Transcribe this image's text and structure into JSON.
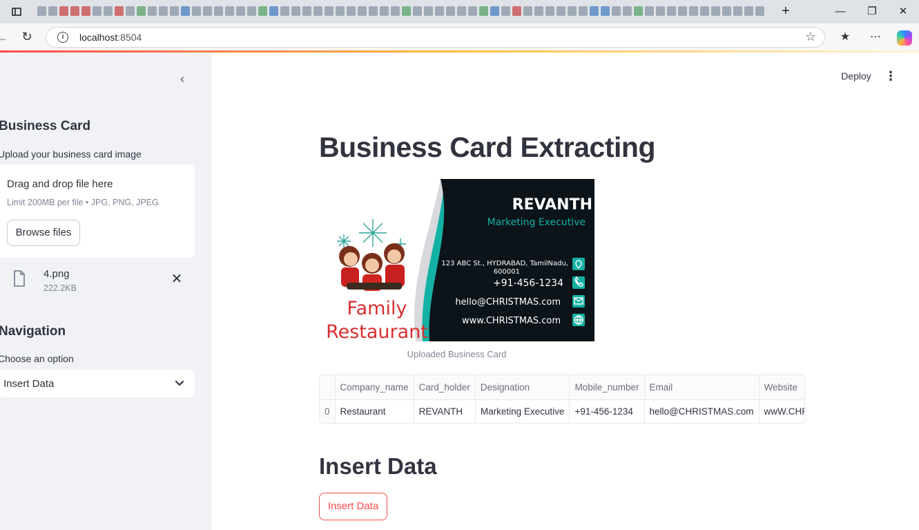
{
  "browser": {
    "new_tab_label": "+",
    "url_host": "localhost",
    "url_port": ":8504"
  },
  "sidebar": {
    "header": "Business Card",
    "upload_label": "Upload your business card image",
    "dropzone_text": "Drag and drop file here",
    "limit_text": "Limit 200MB per file • JPG, PNG, JPEG",
    "browse_button": "Browse files",
    "file": {
      "name": "4.png",
      "size": "222.2KB"
    },
    "nav_header": "Navigation",
    "select_label": "Choose an option",
    "select_value": "Insert Data"
  },
  "main": {
    "deploy_label": "Deploy",
    "title": "Business Card Extracting",
    "image_caption": "Uploaded Business Card",
    "card": {
      "name": "REVANTH",
      "designation": "Marketing Executive",
      "address_line1": "123 ABC St., HYDRABAD, TamilNadu,",
      "address_line2": "600001",
      "phone": "+91-456-1234",
      "email": "hello@CHRISTMAS.com",
      "website": "www.CHRISTMAS.com",
      "brand_line1": "Family",
      "brand_line2": "Restaurant",
      "colors": {
        "dark": "#0c1319",
        "teal": "#14b2a4",
        "brand_red": "#d92f2f"
      }
    },
    "table": {
      "columns": [
        "",
        "Company_name",
        "Card_holder",
        "Designation",
        "Mobile_number",
        "Email",
        "Website"
      ],
      "rows": [
        [
          "0",
          "Restaurant",
          "REVANTH",
          "Marketing Executive",
          "+91-456-1234",
          "hello@CHRISTMAS.com",
          "wwW.CHRISTMAS.com"
        ]
      ]
    },
    "section_title": "Insert Data",
    "insert_button": "Insert Data"
  },
  "colors": {
    "accent": "#ff4b4b",
    "sidebar_bg": "#f0f2f6",
    "text": "#31333f"
  }
}
